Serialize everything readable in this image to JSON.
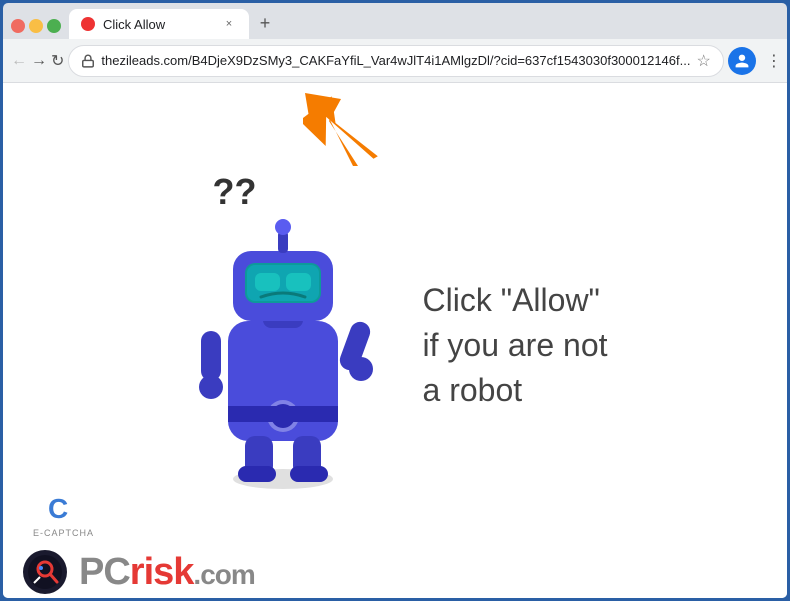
{
  "browser": {
    "tab": {
      "favicon_color": "#e33",
      "title": "Click Allow",
      "close_label": "×",
      "new_tab_label": "+"
    },
    "toolbar": {
      "back_label": "←",
      "forward_label": "→",
      "reload_label": "↻",
      "url": "thezileads.com/B4DjeX9DzSMy3_CAKFaYfiL_Var4wJlT4i1AMlgzDl/?cid=637cf1543030f300012146f...",
      "star_label": "☆",
      "menu_label": "⋮"
    }
  },
  "page": {
    "heading": "Click \"Allow\"",
    "line2": "if you are not",
    "line3": "a robot",
    "question_marks": "??",
    "ecaptcha_label": "E-CAPTCHA"
  },
  "pcrisk": {
    "text_gray": "PC",
    "text_red": "risk",
    "domain": ".com"
  },
  "colors": {
    "robot_body": "#4a4cdb",
    "robot_visor": "#1ab",
    "arrow_orange": "#f57c00",
    "browser_frame": "#2a5fa5"
  }
}
